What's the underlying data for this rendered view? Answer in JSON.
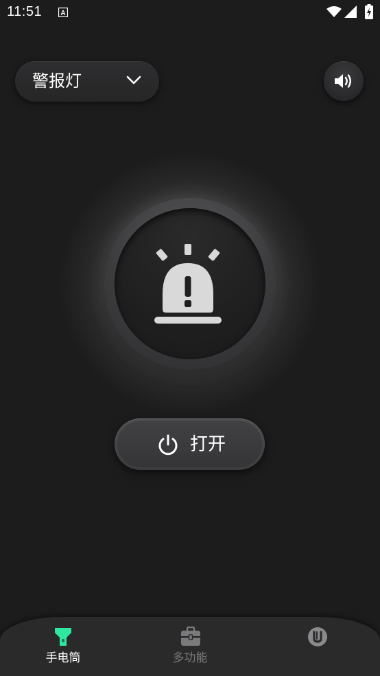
{
  "status_bar": {
    "time": "11:51"
  },
  "mode_selector": {
    "label": "警报灯"
  },
  "alarm": {
    "icon": "alarm-siren-icon"
  },
  "power_button": {
    "label": "打开",
    "icon": "power-icon"
  },
  "bottom_nav": {
    "items": [
      {
        "label": "手电筒",
        "icon": "flashlight-icon",
        "active": true
      },
      {
        "label": "多功能",
        "icon": "toolbox-icon",
        "active": false
      },
      {
        "label": "",
        "icon": "u-badge-icon",
        "active": false
      }
    ]
  },
  "colors": {
    "background": "#1c1c1d",
    "accent_green": "#2ee8a0",
    "icon_light": "#d9d9d9",
    "inactive": "#7a7a7d"
  }
}
